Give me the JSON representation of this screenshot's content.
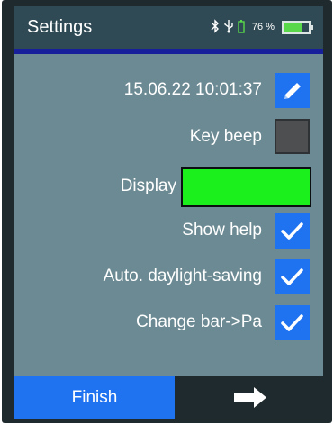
{
  "header": {
    "title": "Settings",
    "status_icons": [
      "bluetooth-icon",
      "usb-icon",
      "battery-small-icon"
    ],
    "battery_percent_label": "76 %",
    "battery_level": 0.76
  },
  "settings": {
    "datetime": "15.06.22  10:01:37",
    "key_beep_label": "Key beep",
    "key_beep_checked": false,
    "display_label": "Display",
    "display_color": "#1cf01c",
    "show_help_label": "Show help",
    "show_help_checked": true,
    "daylight_saving_label": "Auto. daylight-saving",
    "daylight_saving_checked": true,
    "change_bar_label": "Change bar->Pa",
    "change_bar_checked": true
  },
  "footer": {
    "finish_label": "Finish",
    "next_icon": "arrow-right-icon"
  },
  "colors": {
    "screen_bg": "#6c8a93",
    "title_bg": "#2f4a54",
    "accent": "#1f73f0",
    "title_underline": "#17209a",
    "battery_fill": "#58d84a"
  }
}
